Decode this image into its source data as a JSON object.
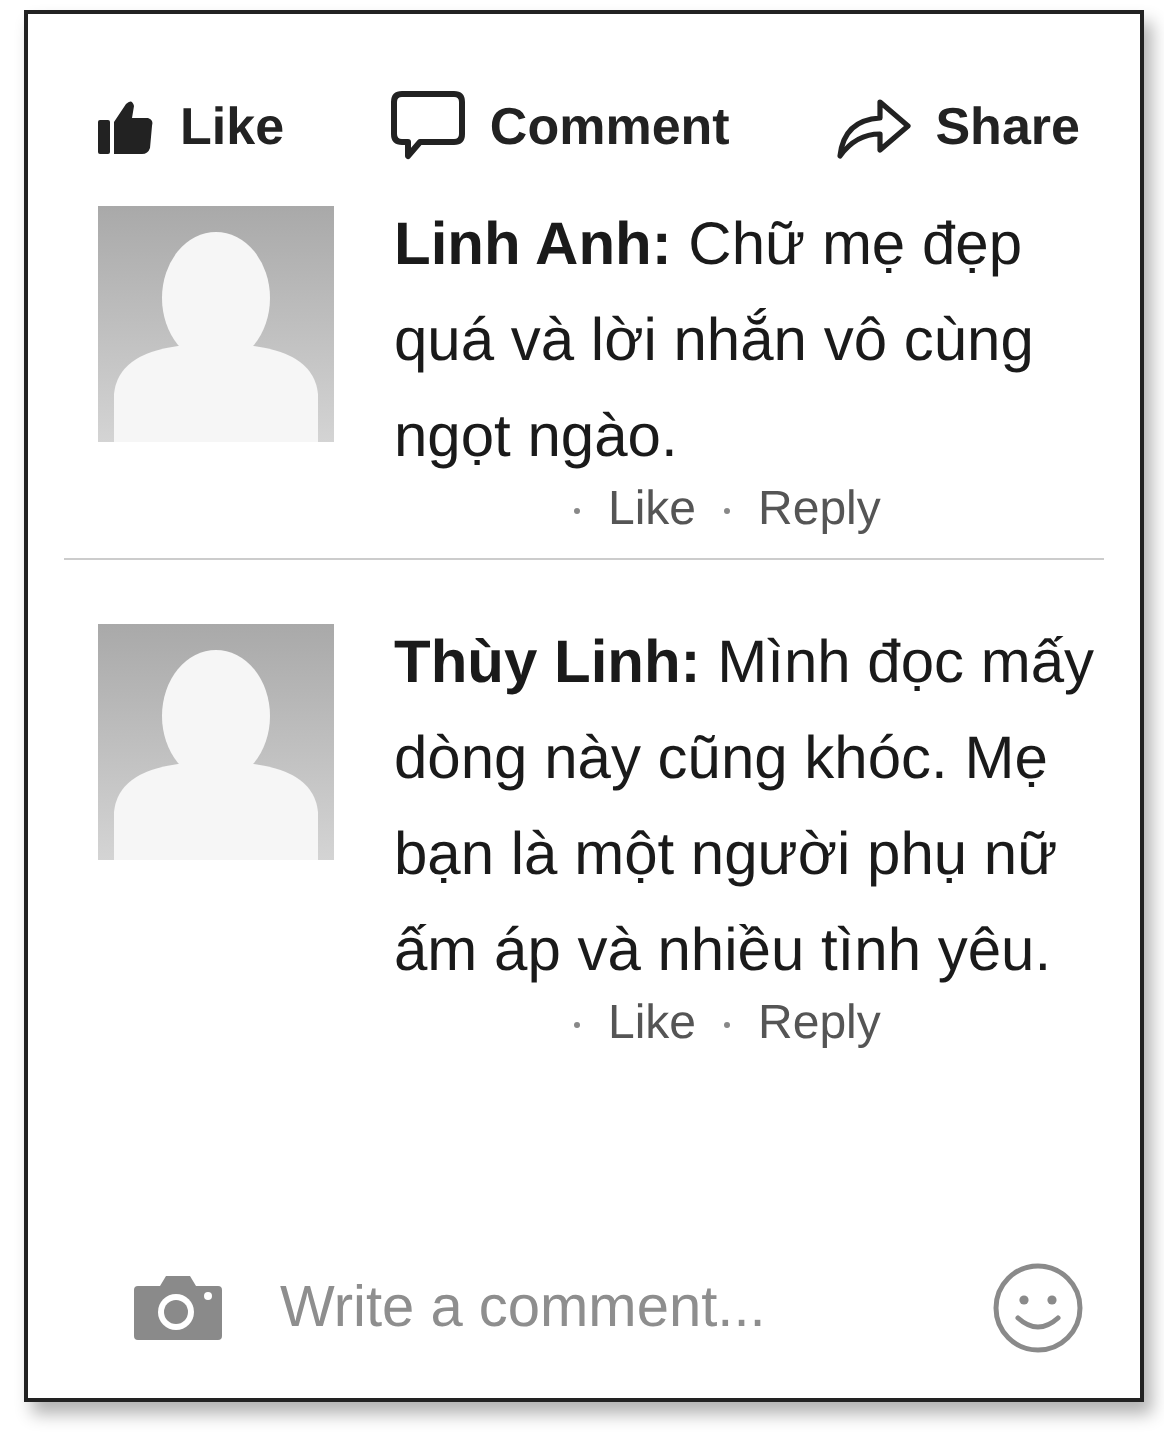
{
  "actions": [
    {
      "kind": "like",
      "label": "Like"
    },
    {
      "kind": "comment",
      "label": "Comment"
    },
    {
      "kind": "share",
      "label": "Share"
    }
  ],
  "comments": [
    {
      "author": "Linh Anh:",
      "text": "Chữ mẹ đẹp quá và lời nhắn vô cùng ngọt ngào.",
      "like": "Like",
      "reply": "Reply"
    },
    {
      "author": "Thùy Linh:",
      "text": "Mình đọc mấy dòng này cũng khóc. Mẹ bạn là một người phụ nữ ấm áp và nhiều tình yêu.",
      "like": "Like",
      "reply": "Reply"
    }
  ],
  "composer": {
    "placeholder": "Write a comment..."
  }
}
